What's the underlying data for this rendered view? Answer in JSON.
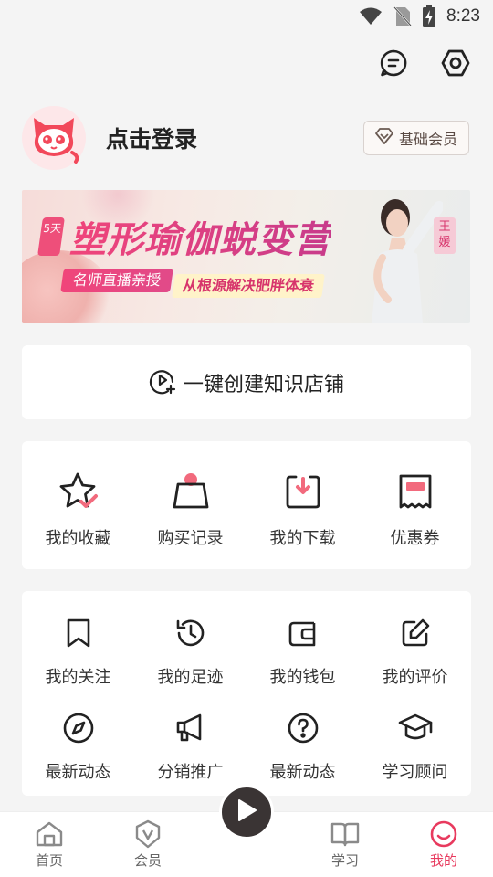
{
  "status_bar": {
    "time": "8:23"
  },
  "top_actions": {
    "icons": [
      "message-icon",
      "settings-icon"
    ]
  },
  "profile": {
    "login_label": "点击登录",
    "member_badge": "基础会员"
  },
  "banner": {
    "days": "5天",
    "headline": "塑形瑜伽蜕变营",
    "tag_1": "名师直播亲授",
    "tag_2": "从根源解决肥胖体衰",
    "coach": "王媛"
  },
  "create_store": {
    "label": "一键创建知识店铺"
  },
  "assets": [
    {
      "label": "我的收藏",
      "icon": "star-icon"
    },
    {
      "label": "购买记录",
      "icon": "shopping-bag-icon"
    },
    {
      "label": "我的下载",
      "icon": "download-icon"
    },
    {
      "label": "优惠券",
      "icon": "coupon-icon"
    }
  ],
  "more": [
    {
      "label": "我的关注",
      "icon": "bookmark-icon"
    },
    {
      "label": "我的足迹",
      "icon": "history-icon"
    },
    {
      "label": "我的钱包",
      "icon": "wallet-icon"
    },
    {
      "label": "我的评价",
      "icon": "edit-icon"
    },
    {
      "label": "最新动态",
      "icon": "compass-icon"
    },
    {
      "label": "分销推广",
      "icon": "megaphone-icon"
    },
    {
      "label": "最新动态",
      "icon": "help-icon"
    },
    {
      "label": "学习顾问",
      "icon": "graduation-cap-icon"
    }
  ],
  "tabbar": {
    "home": "首页",
    "member": "会员",
    "study": "学习",
    "mine": "我的",
    "active_color": "#e83a5e"
  }
}
